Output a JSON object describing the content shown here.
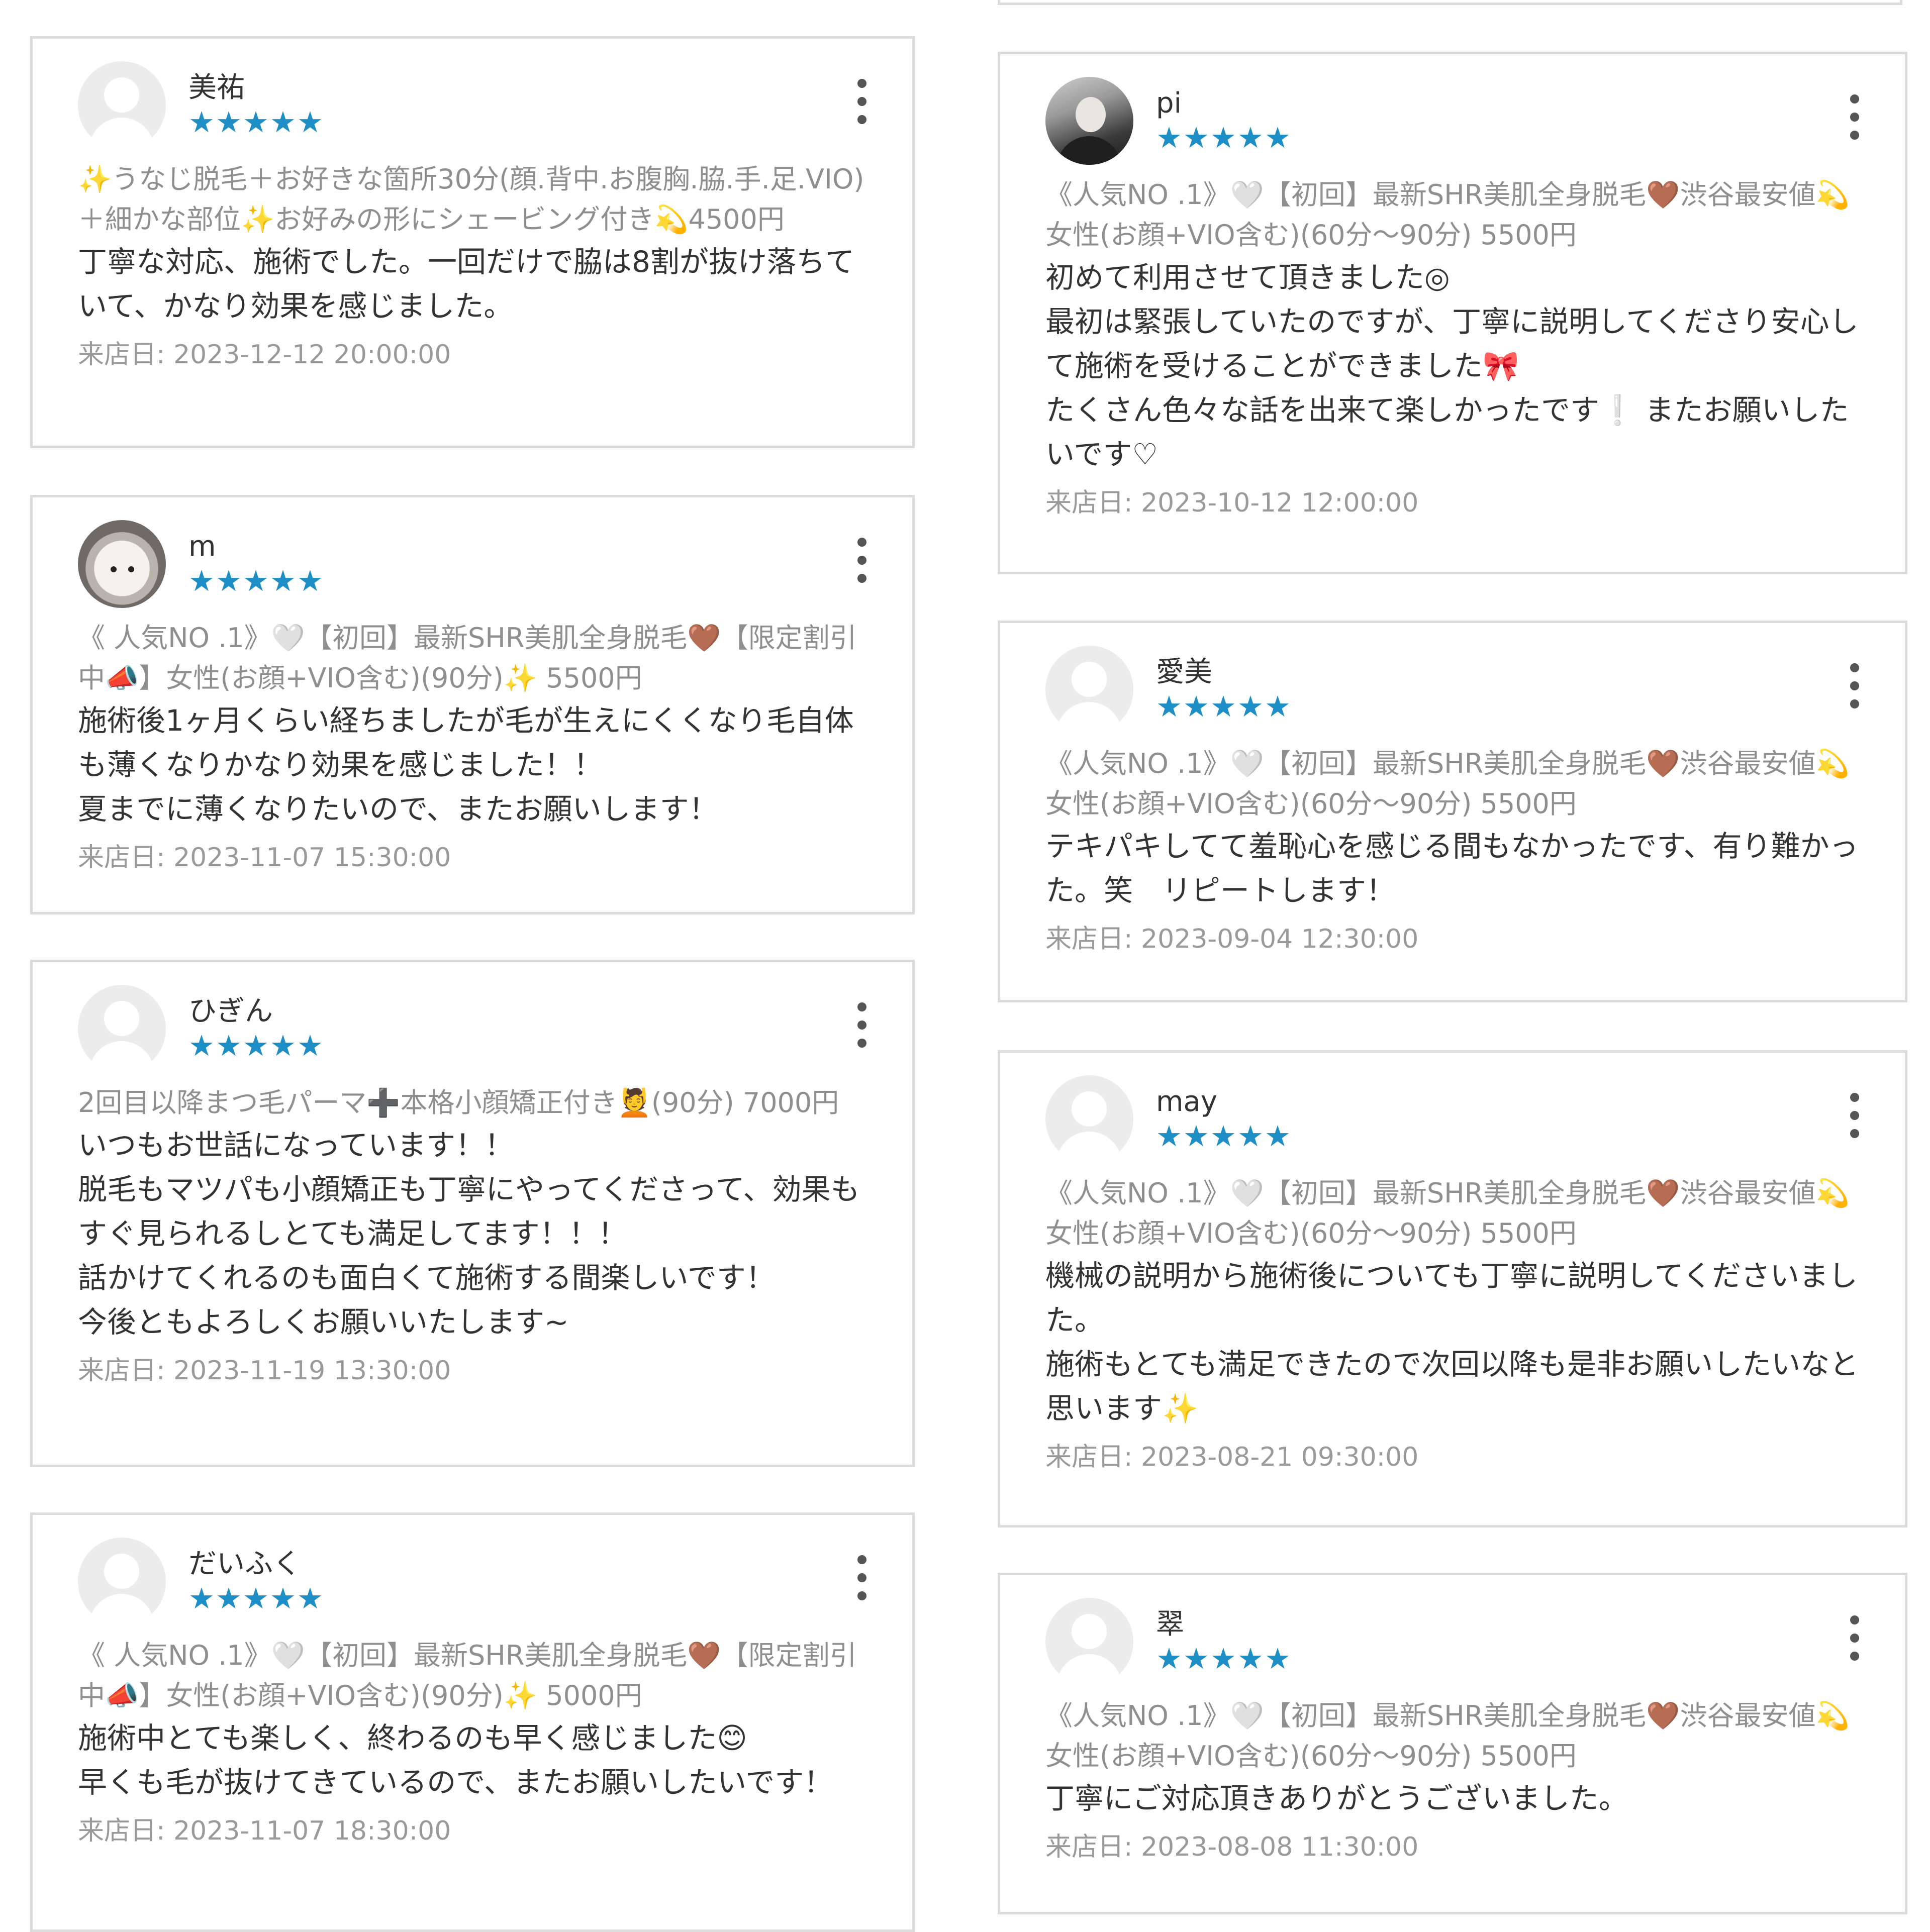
{
  "visit_label": "来店日: ",
  "stars": "★★★★★",
  "reviews": [
    {
      "name": "美祐",
      "menu": "✨うなじ脱毛＋お好きな箇所30分(顔.背中.お腹胸.脇.手.足.VIO)＋細かな部位✨お好みの形にシェービング付き💫4500円",
      "comment": "丁寧な対応、施術でした。一回だけで脇は8割が抜け落ちていて、かなり効果を感じました。",
      "date": "2023-12-12 20:00:00"
    },
    {
      "name": "m",
      "menu": "《 人気NO .1》🤍【初回】最新SHR美肌全身脱毛🤎【限定割引中📣】女性(お顔+VIO含む)(90分)✨ 5500円",
      "comment": "施術後1ヶ月くらい経ちましたが毛が生えにくくなり毛自体も薄くなりかなり効果を感じました！！\n夏までに薄くなりたいので、またお願いします！",
      "date": "2023-11-07 15:30:00"
    },
    {
      "name": "ひぎん",
      "menu": "2回目以降まつ毛パーマ➕本格小顔矯正付き💆(90分) 7000円",
      "comment": "いつもお世話になっています！！\n脱毛もマツパも小顔矯正も丁寧にやってくださって、効果もすぐ見られるしとても満足してます！！！\n話かけてくれるのも面白くて施術する間楽しいです！\n今後ともよろしくお願いいたします~",
      "date": "2023-11-19 13:30:00"
    },
    {
      "name": "だいふく",
      "menu": "《 人気NO .1》🤍【初回】最新SHR美肌全身脱毛🤎【限定割引中📣】女性(お顔+VIO含む)(90分)✨ 5000円",
      "comment": "施術中とても楽しく、終わるのも早く感じました😊\n早くも毛が抜けてきているので、またお願いしたいです！",
      "date": "2023-11-07 18:30:00"
    },
    {
      "name": "pi",
      "menu": "《人気NO .1》🤍【初回】最新SHR美肌全身脱毛🤎渋谷最安値💫女性(お顔+VIO含む)(60分〜90分) 5500円",
      "comment": "初めて利用させて頂きました◎\n最初は緊張していたのですが、丁寧に説明してくださり安心して施術を受けることができました🎀\nたくさん色々な話を出来て楽しかったです❕ またお願いしたいです♡",
      "date": "2023-10-12 12:00:00"
    },
    {
      "name": "愛美",
      "menu": "《人気NO .1》🤍【初回】最新SHR美肌全身脱毛🤎渋谷最安値💫女性(お顔+VIO含む)(60分〜90分) 5500円",
      "comment": "テキパキしてて羞恥心を感じる間もなかったです、有り難かった。笑　リピートします！",
      "date": "2023-09-04 12:30:00"
    },
    {
      "name": "may",
      "menu": "《人気NO .1》🤍【初回】最新SHR美肌全身脱毛🤎渋谷最安値💫女性(お顔+VIO含む)(60分〜90分) 5500円",
      "comment": "機械の説明から施術後についても丁寧に説明してくださいました。\n施術もとても満足できたので次回以降も是非お願いしたいなと思います✨",
      "date": "2023-08-21 09:30:00"
    },
    {
      "name": "翠",
      "menu": "《人気NO .1》🤍【初回】最新SHR美肌全身脱毛🤎渋谷最安値💫女性(お顔+VIO含む)(60分〜90分) 5500円",
      "comment": "丁寧にご対応頂きありがとうございました。",
      "date": "2023-08-08 11:30:00"
    }
  ]
}
